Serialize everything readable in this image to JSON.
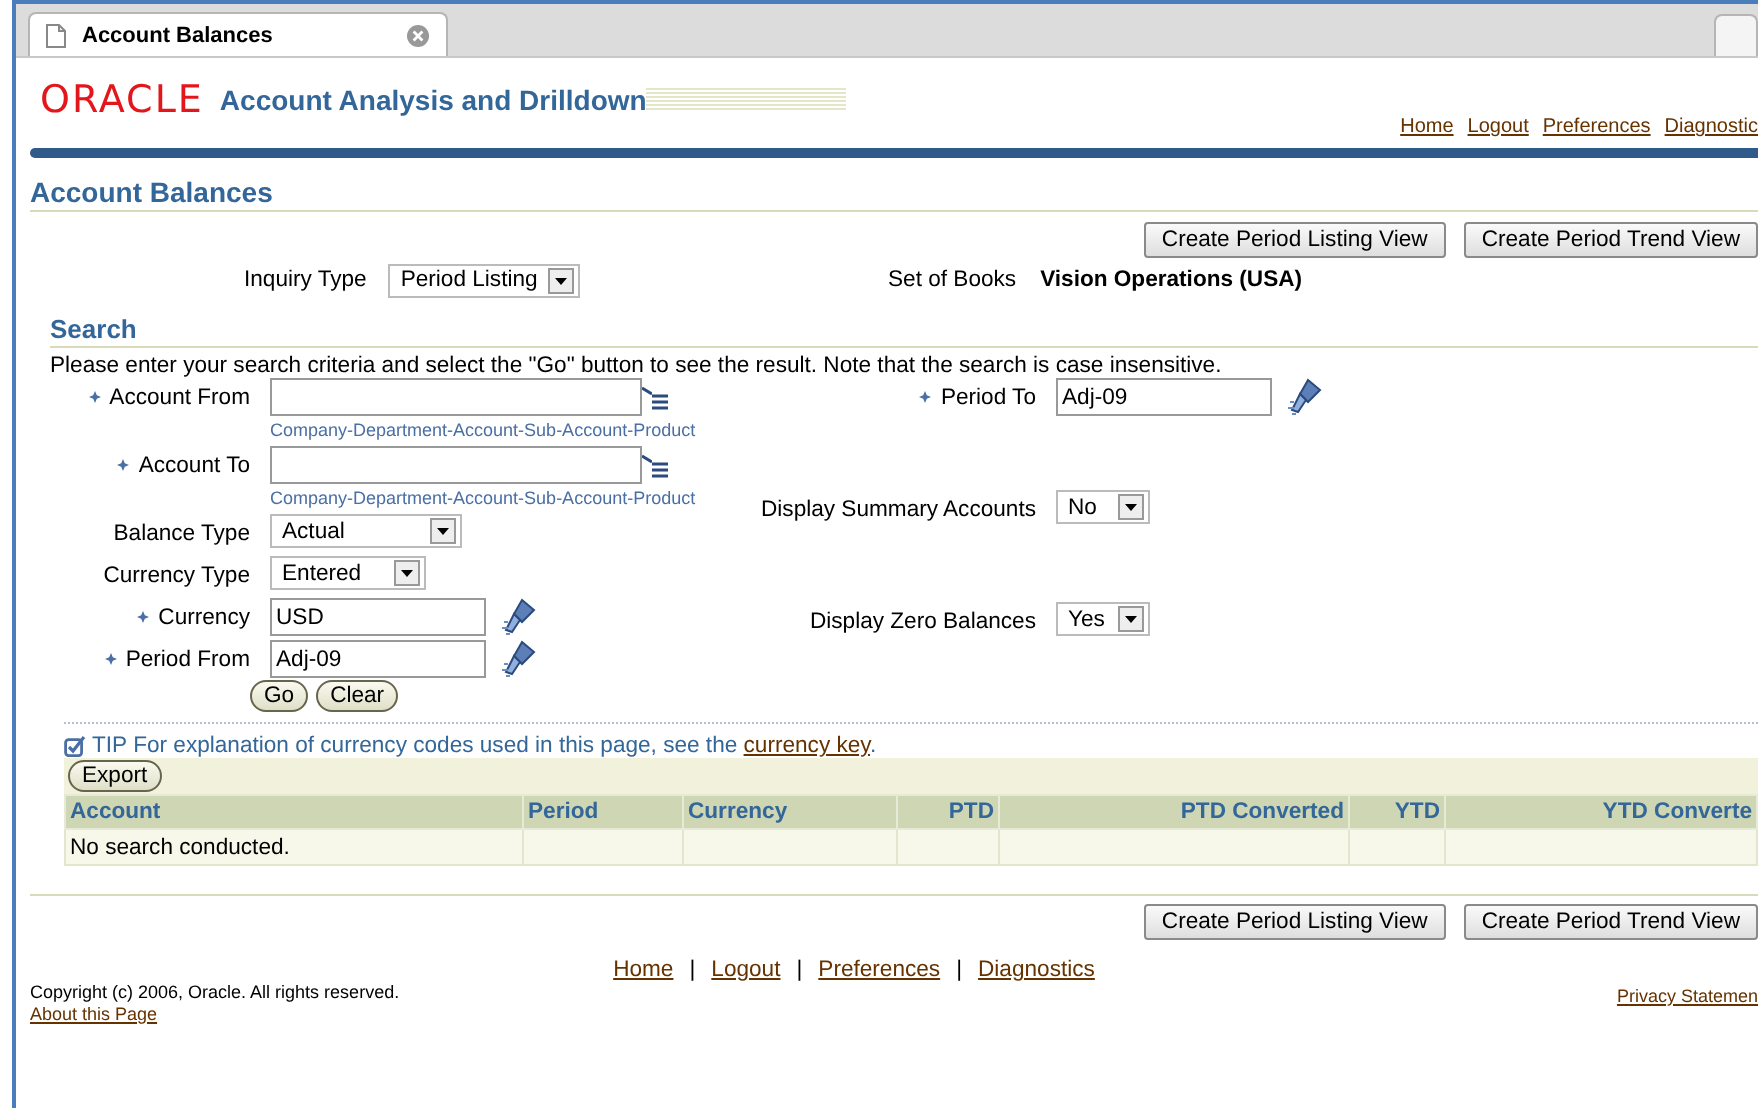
{
  "tab": {
    "title": "Account Balances"
  },
  "header": {
    "logo": "ORACLE",
    "app_title": "Account Analysis and Drilldown",
    "global_links": [
      "Home",
      "Logout",
      "Preferences",
      "Diagnostic"
    ]
  },
  "page_title": "Account Balances",
  "top_buttons": [
    "Create Period Listing View",
    "Create Period Trend View"
  ],
  "inquiry": {
    "label": "Inquiry Type",
    "value": "Period Listing"
  },
  "set_of_books": {
    "label": "Set of Books",
    "value": "Vision Operations (USA)"
  },
  "search": {
    "title": "Search",
    "instruction": "Please enter your search criteria and select the \"Go\" button to see the result. Note that the search is case insensitive.",
    "left_fields": [
      {
        "kind": "flex",
        "label": "Account From",
        "required": true,
        "hint": "Company-Department-Account-Sub-Account-Product"
      },
      {
        "kind": "flex",
        "label": "Account To",
        "required": true,
        "hint": "Company-Department-Account-Sub-Account-Product"
      },
      {
        "kind": "select",
        "label": "Balance Type",
        "required": false,
        "value": "Actual"
      },
      {
        "kind": "select",
        "label": "Currency Type",
        "required": false,
        "value": "Entered"
      },
      {
        "kind": "lov",
        "label": "Currency",
        "required": true,
        "value": "USD"
      },
      {
        "kind": "lov",
        "label": "Period From",
        "required": true,
        "value": "Adj-09"
      }
    ],
    "right_fields": [
      {
        "kind": "lov",
        "label": "Period To",
        "required": true,
        "value": "Adj-09"
      },
      {
        "kind": "select",
        "label": "Display Summary Accounts",
        "required": false,
        "value": "No"
      },
      {
        "kind": "select",
        "label": "Display Zero Balances",
        "required": false,
        "value": "Yes"
      }
    ],
    "buttons": [
      "Go",
      "Clear"
    ]
  },
  "tip": {
    "label": "TIP",
    "text": "For explanation of currency codes used in this page, see the",
    "link": "currency key",
    "end": "."
  },
  "results": {
    "export_button": "Export",
    "columns": [
      {
        "label": "Account"
      },
      {
        "label": "Period"
      },
      {
        "label": "Currency"
      },
      {
        "label": "PTD"
      },
      {
        "label": "PTD Converted"
      },
      {
        "label": "YTD"
      },
      {
        "label": "YTD Converte"
      }
    ],
    "empty_message": "No search conducted."
  },
  "bottom_buttons": [
    "Create Period Listing View",
    "Create Period Trend View"
  ],
  "footer": {
    "links": [
      "Home",
      "Logout",
      "Preferences",
      "Diagnostics"
    ],
    "separators": [
      "|",
      "|",
      "|"
    ],
    "copyright": "Copyright (c) 2006, Oracle. All rights reserved.",
    "about_link": "About this Page",
    "privacy_link": "Privacy Statemen"
  }
}
